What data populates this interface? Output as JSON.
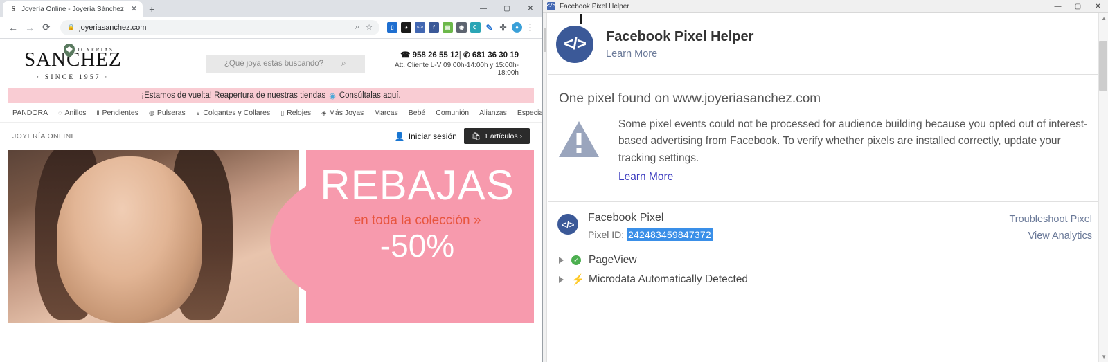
{
  "browser": {
    "tab": {
      "favicon": "S",
      "title": "Joyería Online - Joyería Sánchez",
      "close": "✕"
    },
    "newtab_label": "+",
    "window_controls": {
      "minimize": "—",
      "maximize": "▢",
      "close": "✕"
    },
    "nav": {
      "back": "←",
      "forward": "→",
      "reload": "⟳"
    },
    "omnibox": {
      "lock": "🔒",
      "url": "joyeriasanchez.com"
    },
    "omni_actions": {
      "zoom": "⌕",
      "bookmark": "☆"
    },
    "extensions": [
      {
        "name": "bitwarden-extension",
        "glyph": "▯",
        "color": "#1f6fd0"
      },
      {
        "name": "dark-reader-extension",
        "glyph": "◕",
        "color": "#1a1a1a"
      },
      {
        "name": "pixel-helper-extension",
        "glyph": "</>",
        "color": "#4267b2"
      },
      {
        "name": "facebook-extension",
        "glyph": "f",
        "color": "#3b5998"
      },
      {
        "name": "keyboard-extension",
        "glyph": "▤",
        "color": "#6cb84a"
      },
      {
        "name": "globe-extension",
        "glyph": "◉",
        "color": "#5d6470"
      },
      {
        "name": "moon-extension",
        "glyph": "☾",
        "color": "#2aa5b5"
      },
      {
        "name": "pen-extension",
        "glyph": "✎",
        "color": "#1f6fd0"
      },
      {
        "name": "puzzle-extension",
        "glyph": "✜",
        "color": "#5f6368"
      },
      {
        "name": "profile-avatar",
        "glyph": "●",
        "color": "#3aa0d8"
      }
    ],
    "menu_dots": "⋮"
  },
  "site": {
    "logo": {
      "top": "JOYERIAS",
      "main": "SANCHEZ",
      "since": "· SINCE 1957 ·"
    },
    "search": {
      "placeholder": "¿Qué joya estás buscando?",
      "icon": "⌕"
    },
    "contact": {
      "phone1_icon": "☎",
      "phone1": "958 26 55 12",
      "separator": "|",
      "phone2_icon": "✆",
      "phone2": "681 36 30 19",
      "hours": "Att. Cliente L-V 09:00h-14:00h y 15:00h-18:00h"
    },
    "promo": {
      "text": "¡Estamos de vuelta! Reapertura de nuestras tiendas",
      "marker": "◉",
      "link": "Consúltalas aquí."
    },
    "nav_items": [
      {
        "label": "PANDORA",
        "icon": ""
      },
      {
        "label": "Anillos",
        "icon": "◌"
      },
      {
        "label": "Pendientes",
        "icon": "ii"
      },
      {
        "label": "Pulseras",
        "icon": "◍"
      },
      {
        "label": "Colgantes y Collares",
        "icon": "∨"
      },
      {
        "label": "Relojes",
        "icon": "▯"
      },
      {
        "label": "Más Joyas",
        "icon": "◈"
      },
      {
        "label": "Marcas",
        "icon": ""
      },
      {
        "label": "Bebé",
        "icon": ""
      },
      {
        "label": "Comunión",
        "icon": ""
      },
      {
        "label": "Alianzas",
        "icon": ""
      },
      {
        "label": "Especial Madre",
        "icon": ""
      }
    ],
    "subbar": {
      "label": "JOYERÍA ONLINE",
      "login_icon": "👤",
      "login": "Iniciar sesión",
      "cart_icon": "🛍",
      "cart": "1 artículos ›"
    },
    "hero": {
      "title": "REBAJAS",
      "subtitle": "en toda la colección »",
      "discount": "-50%"
    }
  },
  "pixel_helper": {
    "window_title": "Facebook Pixel Helper",
    "window_icon": "</>",
    "window_controls": {
      "minimize": "—",
      "maximize": "▢",
      "close": "✕"
    },
    "header": {
      "icon": "</>",
      "title": "Facebook Pixel Helper",
      "learn_more": "Learn More"
    },
    "found_text": "One pixel found on www.joyeriasanchez.com",
    "warning": {
      "icon": "warning-triangle",
      "body": "Some pixel events could not be processed for audience building because you opted out of interest-based advertising from Facebook. To verify whether pixels are installed correctly, update your tracking settings.",
      "link": "Learn More"
    },
    "pixel": {
      "icon": "</>",
      "name": "Facebook Pixel",
      "id_label": "Pixel ID:",
      "id_value": "242483459847372",
      "troubleshoot_link": "Troubleshoot Pixel",
      "analytics_link": "View Analytics"
    },
    "events": [
      {
        "label": "PageView",
        "status": "ok",
        "glyph": "✓"
      },
      {
        "label": "Microdata Automatically Detected",
        "status": "info",
        "glyph": "⚡"
      }
    ]
  },
  "colors": {
    "fb_blue": "#3b5998",
    "promo_pink": "#f9ccd3",
    "hero_pink": "#f79aad",
    "accent_red": "#e8553f",
    "link_blue": "#6b7a99",
    "success_green": "#4caf50"
  }
}
